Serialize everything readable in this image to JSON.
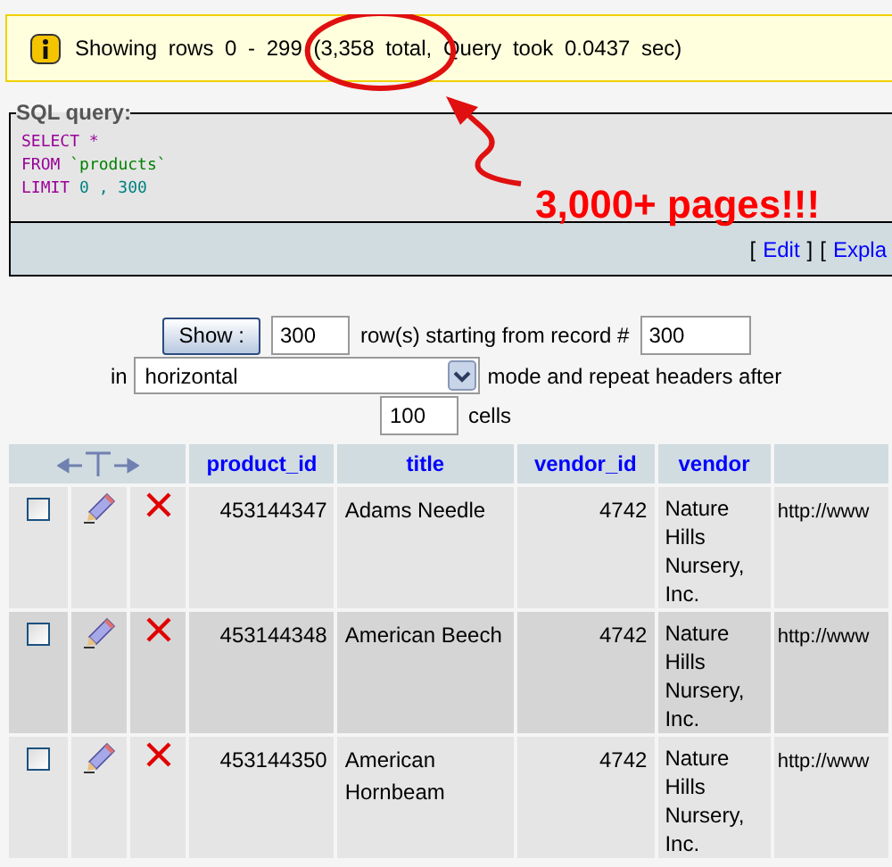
{
  "notice": {
    "text": "Showing rows 0 - 299 (3,358 total, Query took 0.0437 sec)"
  },
  "sql_query": {
    "legend": "SQL query:",
    "lines": [
      {
        "parts": [
          {
            "kind": "keyword",
            "text": "SELECT"
          },
          {
            "kind": "operator",
            "text": "*"
          }
        ]
      },
      {
        "parts": [
          {
            "kind": "keyword",
            "text": "FROM"
          },
          {
            "kind": "identifier",
            "text": "`products`"
          }
        ]
      },
      {
        "parts": [
          {
            "kind": "keyword",
            "text": "LIMIT"
          },
          {
            "kind": "number",
            "text": "0 , 300"
          }
        ]
      }
    ],
    "links": [
      {
        "open": "[",
        "label": "Edit",
        "close": "]"
      },
      {
        "open": "[",
        "label": "Expla"
      }
    ]
  },
  "annotation": {
    "text": "3,000+ pages!!!"
  },
  "navigation": {
    "button": "Show :",
    "rows": "300",
    "rows_label": "row(s) starting from record #",
    "start": "300",
    "in_label": "in",
    "mode": "horizontal",
    "mode_label": "mode and repeat headers after",
    "repeat": "100",
    "repeat_label": "cells"
  },
  "table": {
    "columns": [
      "product_id",
      "title",
      "vendor_id",
      "vendor"
    ],
    "rows": [
      {
        "checked": false,
        "product_id": "453144347",
        "title": "Adams Needle",
        "vendor_id": "4742",
        "vendor": "Nature Hills Nursery, Inc.",
        "column_5": "http://www"
      },
      {
        "checked": false,
        "product_id": "453144348",
        "title": "American Beech",
        "vendor_id": "4742",
        "vendor": "Nature Hills Nursery, Inc.",
        "column_5": "http://www"
      },
      {
        "checked": false,
        "product_id": "453144350",
        "title": "American Hornbeam",
        "vendor_id": "4742",
        "vendor": "Nature Hills Nursery, Inc.",
        "column_5": "http://www"
      }
    ]
  }
}
